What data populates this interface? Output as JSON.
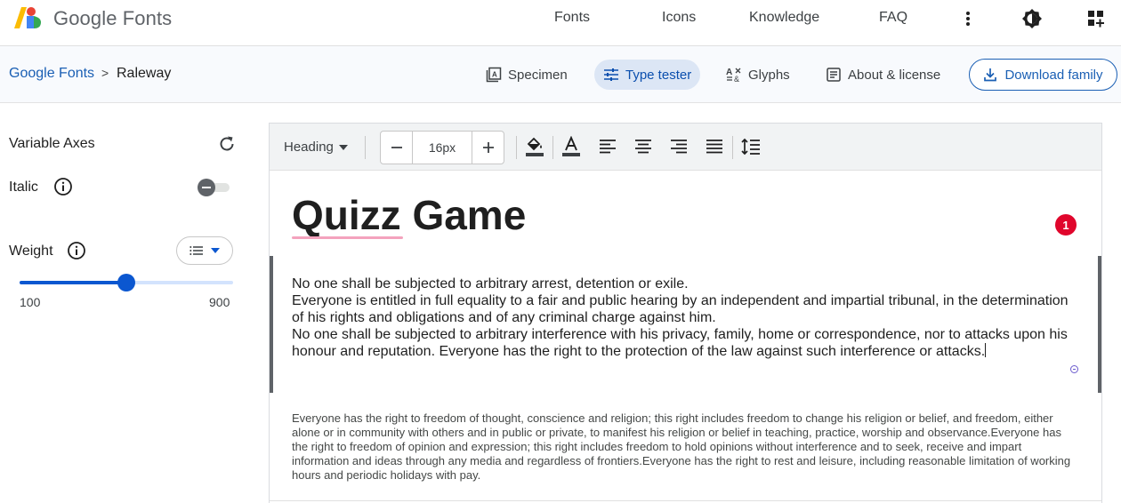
{
  "header": {
    "brand": "Google Fonts",
    "nav": [
      "Fonts",
      "Icons",
      "Knowledge",
      "FAQ"
    ],
    "icons": [
      "more-vert-icon",
      "theme-toggle-icon",
      "apps-grid-icon"
    ]
  },
  "breadcrumb": {
    "root": "Google Fonts",
    "separator": ">",
    "current": "Raleway"
  },
  "tabs": [
    {
      "label": "Specimen",
      "icon": "specimen-icon",
      "active": false
    },
    {
      "label": "Type tester",
      "icon": "sliders-icon",
      "active": true
    },
    {
      "label": "Glyphs",
      "icon": "glyphs-icon",
      "active": false
    },
    {
      "label": "About & license",
      "icon": "document-icon",
      "active": false
    }
  ],
  "download": {
    "label": "Download family",
    "icon": "download-icon"
  },
  "sidebar": {
    "title": "Variable Axes",
    "italic_label": "Italic",
    "italic_on": false,
    "weight_label": "Weight",
    "weight_min": "100",
    "weight_max": "900",
    "weight_value_fraction": 0.5
  },
  "toolbar": {
    "style_select": "Heading",
    "font_size": "16px"
  },
  "editor": {
    "heading": "Quizz Game",
    "error_count": "1",
    "paragraph_lines": [
      "No one shall be subjected to arbitrary arrest, detention or exile.",
      "Everyone is entitled in full equality to a fair and public hearing by an independent and impartial tribunal, in the determination of his rights and obligations and of any criminal charge against him.",
      "No one shall be subjected to arbitrary interference with his privacy, family, home or correspondence, nor to attacks upon his honour and reputation. Everyone has the right to the protection of the law against such interference or attacks."
    ],
    "small_paragraph": "Everyone has the right to freedom of thought, conscience and religion; this right includes freedom to change his religion or belief, and freedom, either alone or in community with others and in public or private, to manifest his religion or belief in teaching, practice, worship and observance.Everyone has the right to freedom of opinion and expression; this right includes freedom to hold opinions without interference and to seek, receive and impart information and ideas through any media and regardless of frontiers.Everyone has the right to rest and leisure, including reasonable limitation of working hours and periodic holidays with pay."
  },
  "colors": {
    "accent": "#0b57d0",
    "link": "#1a5fb4",
    "active_tab_bg": "#dce6f5",
    "error": "#e0062c",
    "spell_underline": "#f4a3bd"
  }
}
